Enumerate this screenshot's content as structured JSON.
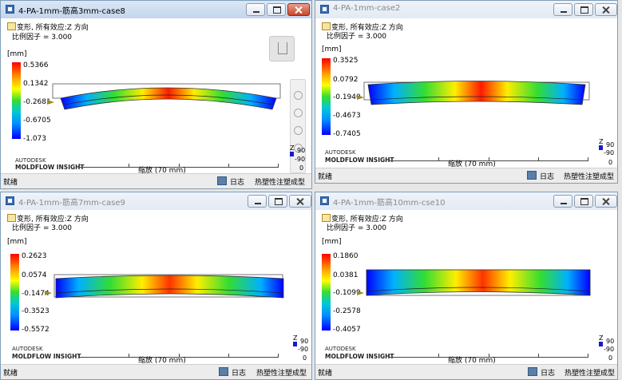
{
  "colors": {
    "hot": "#ff0000",
    "mid": "#33dd33",
    "cold": "#0000ff",
    "marker": "#9a8a2a"
  },
  "common": {
    "plot_label": "变形, 所有效应:Z 方向",
    "scale_factor": "比例因子 = 3.000",
    "unit": "[mm]",
    "logo_line1": "AUTODESK",
    "logo_line2": "MOLDFLOW INSIGHT",
    "ruler_label": "缩放 (70 mm)",
    "status_ready": "就绪",
    "status_log": "日志",
    "status_mode": "热塑性注塑成型",
    "axis_z": "Z",
    "axis_vals": [
      "90",
      "-90",
      "0"
    ]
  },
  "windows": [
    {
      "title": "4-PA-1mm-筋高3mm-case8",
      "active": true,
      "legend": [
        "0.5366",
        "0.1342",
        "-0.2681",
        "-0.6705",
        "-1.073"
      ],
      "icons": [
        "window-icon",
        "minimize-icon",
        "maximize-icon",
        "close-icon"
      ]
    },
    {
      "title": "4-PA-1mm-case2",
      "active": false,
      "legend": [
        "0.3525",
        "0.0792",
        "-0.1940",
        "-0.4673",
        "-0.7405"
      ]
    },
    {
      "title": "4-PA-1mm-筋高7mm-case9",
      "active": false,
      "legend": [
        "0.2623",
        "0.0574",
        "-0.1474",
        "-0.3523",
        "-0.5572"
      ]
    },
    {
      "title": "4-PA-1mm-筋高10mm-cse10",
      "active": false,
      "legend": [
        "0.1860",
        "0.0381",
        "-0.1099",
        "-0.2578",
        "-0.4057"
      ]
    }
  ]
}
